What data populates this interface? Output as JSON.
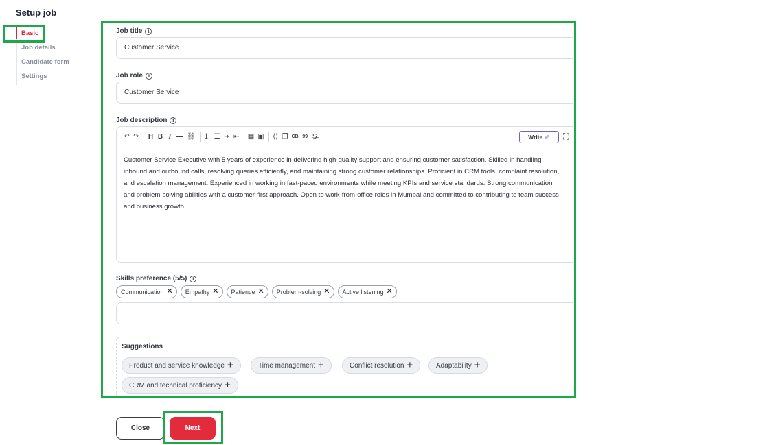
{
  "page": {
    "title": "Setup job"
  },
  "sidebar": {
    "items": [
      {
        "label": "Basic"
      },
      {
        "label": "Job details"
      },
      {
        "label": "Candidate form"
      },
      {
        "label": "Settings"
      }
    ]
  },
  "form": {
    "job_title": {
      "label": "Job title",
      "value": "Customer Service"
    },
    "job_role": {
      "label": "Job role",
      "value": "Customer Service"
    },
    "job_description": {
      "label": "Job description",
      "write_button": "Write",
      "toolbar": {
        "undo": "↶",
        "redo": "↷",
        "heading": "H",
        "bold": "B",
        "italic": "I",
        "hr": "—",
        "link": "⛓",
        "ordered_list": "⒈",
        "bullet_list": "☰",
        "indent": "⇥",
        "outdent": "⇤",
        "table": "▦",
        "image": "▣",
        "code": "⟨⟩",
        "copy": "❐",
        "codeblock": "CB",
        "quote": "99",
        "strike": "S̶"
      },
      "text": "Customer Service Executive with 5 years of experience in delivering high-quality support and ensuring customer satisfaction. Skilled in handling inbound and outbound calls, resolving queries efficiently, and maintaining strong customer relationships. Proficient in CRM tools, complaint resolution, and escalation management. Experienced in working in fast-paced environments while meeting KPIs and service standards. Strong communication and problem-solving abilities with a customer-first approach. Open to work-from-office roles in Mumbai and committed to contributing to team success and business growth."
    },
    "skills": {
      "label": "Skills preference (5/5)",
      "selected": [
        "Communication",
        "Empathy",
        "Patience",
        "Problem-solving",
        "Active listening"
      ],
      "input_value": ""
    },
    "suggestions": {
      "title": "Suggestions",
      "items": [
        "Product and service knowledge",
        "Time management",
        "Conflict resolution",
        "Adaptability",
        "CRM and technical proficiency"
      ]
    }
  },
  "actions": {
    "close_label": "Close",
    "next_label": "Next"
  },
  "colors": {
    "accent": "#d6283a",
    "next_button": "#e32c3b",
    "highlight": "#1fa84a",
    "write_border": "#6b63c9"
  },
  "icons": {
    "info": "info-icon",
    "remove": "close-icon",
    "add": "plus-icon",
    "write": "magic-wand-icon",
    "expand": "expand-icon"
  }
}
